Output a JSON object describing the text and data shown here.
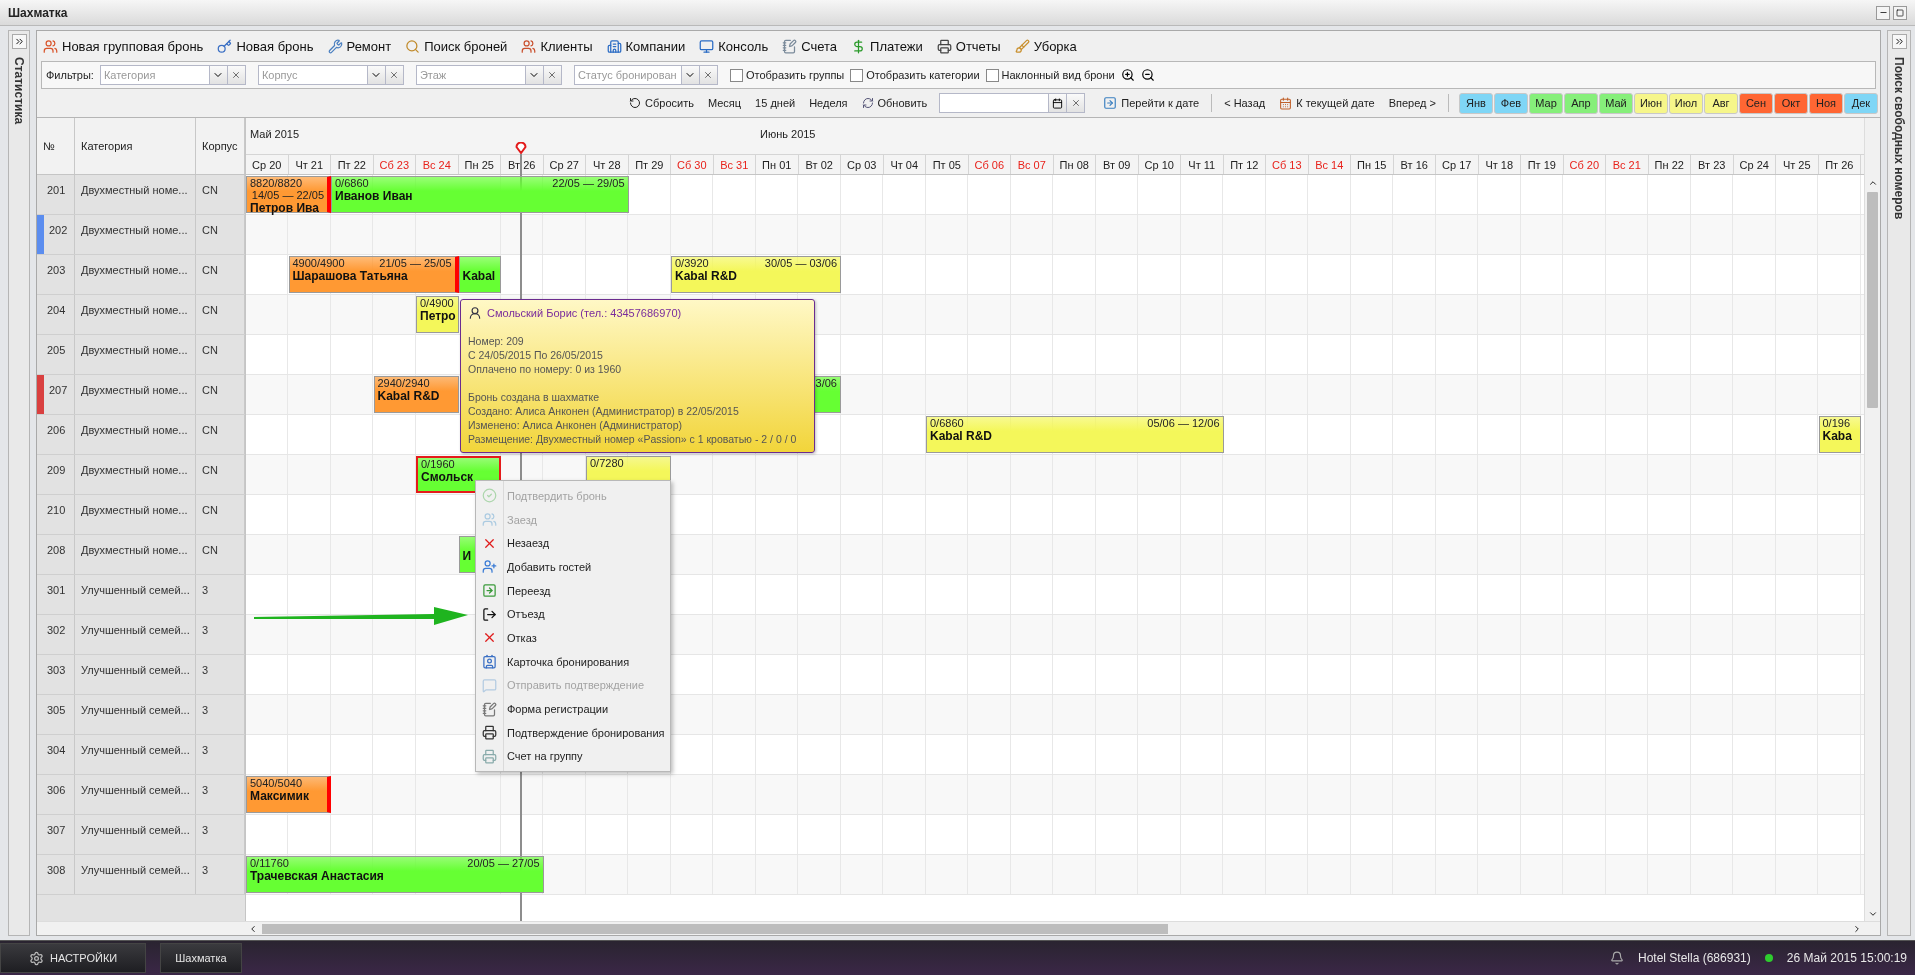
{
  "window": {
    "title": "Шахматка"
  },
  "left_panel": {
    "title": "Статистика"
  },
  "right_panel": {
    "title": "Поиск свободных номеров"
  },
  "toolbar": [
    "Новая групповая бронь",
    "Новая бронь",
    "Ремонт",
    "Поиск броней",
    "Клиенты",
    "Компании",
    "Консоль",
    "Счета",
    "Платежи",
    "Отчеты",
    "Уборка"
  ],
  "filters": {
    "label": "Фильтры:",
    "combos": [
      {
        "placeholder": "Категория"
      },
      {
        "placeholder": "Корпус"
      },
      {
        "placeholder": "Этаж"
      },
      {
        "placeholder": "Статус бронирован"
      }
    ],
    "checkboxes": [
      {
        "label": "Отобразить группы",
        "checked": false
      },
      {
        "label": "Отобразить категории",
        "checked": false
      },
      {
        "label": "Наклонный вид брони",
        "checked": false
      }
    ]
  },
  "nav": {
    "reset": "Сбросить",
    "views": [
      "Месяц",
      "15 дней",
      "Неделя"
    ],
    "refresh": "Обновить",
    "goto": "Перейти к дате",
    "back": "< Назад",
    "current": "К текущей дате",
    "forward": "Вперед >",
    "months": [
      {
        "label": "Янв",
        "color": "#7fd6f6"
      },
      {
        "label": "Фев",
        "color": "#7fd6f6"
      },
      {
        "label": "Мар",
        "color": "#86ef7a"
      },
      {
        "label": "Апр",
        "color": "#86ef7a"
      },
      {
        "label": "Май",
        "color": "#86ef7a"
      },
      {
        "label": "Июн",
        "color": "#f6f68a"
      },
      {
        "label": "Июл",
        "color": "#f6f68a"
      },
      {
        "label": "Авг",
        "color": "#f6f68a"
      },
      {
        "label": "Сен",
        "color": "#ff6633"
      },
      {
        "label": "Окт",
        "color": "#ff6633"
      },
      {
        "label": "Ноя",
        "color": "#ff6633"
      },
      {
        "label": "Дек",
        "color": "#7fd6f6"
      }
    ]
  },
  "grid": {
    "columns": [
      "№",
      "Категория",
      "Корпус"
    ],
    "days": [
      {
        "label": "Ср 20",
        "month": "Май 2015",
        "weekend": false,
        "today": false
      },
      {
        "label": "Чт 21",
        "weekend": false,
        "today": false
      },
      {
        "label": "Пт 22",
        "weekend": false,
        "today": false
      },
      {
        "label": "Сб 23",
        "weekend": true,
        "today": false
      },
      {
        "label": "Вс 24",
        "weekend": true,
        "today": false
      },
      {
        "label": "Пн 25",
        "weekend": false,
        "today": false
      },
      {
        "label": "Вт 26",
        "weekend": false,
        "today": true
      },
      {
        "label": "Ср 27",
        "weekend": false,
        "today": false
      },
      {
        "label": "Чт 28",
        "weekend": false,
        "today": false
      },
      {
        "label": "Пт 29",
        "weekend": false,
        "today": false
      },
      {
        "label": "Сб 30",
        "weekend": true,
        "today": false
      },
      {
        "label": "Вс 31",
        "weekend": true,
        "today": false
      },
      {
        "label": "Пн 01",
        "month": "Июнь 2015",
        "weekend": false,
        "today": false
      },
      {
        "label": "Вт 02",
        "weekend": false,
        "today": false
      },
      {
        "label": "Ср 03",
        "weekend": false,
        "today": false
      },
      {
        "label": "Чт 04",
        "weekend": false,
        "today": false
      },
      {
        "label": "Пт 05",
        "weekend": false,
        "today": false
      },
      {
        "label": "Сб 06",
        "weekend": true,
        "today": false
      },
      {
        "label": "Вс 07",
        "weekend": true,
        "today": false
      },
      {
        "label": "Пн 08",
        "weekend": false,
        "today": false
      },
      {
        "label": "Вт 09",
        "weekend": false,
        "today": false
      },
      {
        "label": "Ср 10",
        "weekend": false,
        "today": false
      },
      {
        "label": "Чт 11",
        "weekend": false,
        "today": false
      },
      {
        "label": "Пт 12",
        "weekend": false,
        "today": false
      },
      {
        "label": "Сб 13",
        "weekend": true,
        "today": false
      },
      {
        "label": "Вс 14",
        "weekend": true,
        "today": false
      },
      {
        "label": "Пн 15",
        "weekend": false,
        "today": false
      },
      {
        "label": "Вт 16",
        "weekend": false,
        "today": false
      },
      {
        "label": "Ср 17",
        "weekend": false,
        "today": false
      },
      {
        "label": "Чт 18",
        "weekend": false,
        "today": false
      },
      {
        "label": "Пт 19",
        "weekend": false,
        "today": false
      },
      {
        "label": "Сб 20",
        "weekend": true,
        "today": false
      },
      {
        "label": "Вс 21",
        "weekend": true,
        "today": false
      },
      {
        "label": "Пн 22",
        "weekend": false,
        "today": false
      },
      {
        "label": "Вт 23",
        "weekend": false,
        "today": false
      },
      {
        "label": "Ср 24",
        "weekend": false,
        "today": false
      },
      {
        "label": "Чт 25",
        "weekend": false,
        "today": false
      },
      {
        "label": "Пт 26",
        "weekend": false,
        "today": false
      }
    ],
    "rooms": [
      {
        "number": "201",
        "category": "Двухместный номе...",
        "building": "CN",
        "timeline": [
          {
            "kind": "booking",
            "amount": "8820/8820",
            "dates": "14/05 — 22/05",
            "name": "Петров Ива",
            "color": "#ff9933",
            "alert": true,
            "selected": false,
            "nights": [
              {
                "kind": "night"
              },
              {
                "kind": "night"
              }
            ]
          },
          {
            "kind": "booking",
            "amount": "0/6860",
            "dates": "22/05 — 29/05",
            "name": "Иванов Иван",
            "color": "#66ff33",
            "alert": false,
            "selected": false,
            "nights": [
              {
                "kind": "night"
              },
              {
                "kind": "night"
              },
              {
                "kind": "night"
              },
              {
                "kind": "night"
              },
              {
                "kind": "night"
              },
              {
                "kind": "night"
              },
              {
                "kind": "night"
              }
            ]
          }
        ]
      },
      {
        "number": "202",
        "category": "Двухместный номе...",
        "building": "CN",
        "color": "#5b8def"
      },
      {
        "number": "203",
        "category": "Двухместный номе...",
        "building": "CN",
        "timeline": [
          {
            "kind": "free"
          },
          {
            "kind": "booking",
            "amount": "4900/4900",
            "dates": "21/05 — 25/05",
            "name": "Шарашова Татьяна",
            "color": "#ff9933",
            "alert": true,
            "selected": false,
            "nights": [
              {
                "kind": "night"
              },
              {
                "kind": "night"
              },
              {
                "kind": "night"
              },
              {
                "kind": "night"
              }
            ]
          },
          {
            "kind": "booking",
            "name": "Kabal",
            "color": "#66ff33",
            "alert": false,
            "selected": false,
            "nights": [
              {
                "kind": "night"
              }
            ]
          },
          {
            "kind": "free"
          },
          {
            "kind": "free"
          },
          {
            "kind": "free"
          },
          {
            "kind": "free"
          },
          {
            "kind": "booking",
            "amount": "0/3920",
            "dates": "30/05 — 03/06",
            "name": "Kabal R&D",
            "color": "#f4f75a",
            "alert": false,
            "selected": false,
            "nights": [
              {
                "kind": "night"
              },
              {
                "kind": "night"
              },
              {
                "kind": "night"
              },
              {
                "kind": "night"
              }
            ]
          }
        ]
      },
      {
        "number": "204",
        "category": "Двухместный номе...",
        "building": "CN",
        "timeline": [
          {
            "kind": "free"
          },
          {
            "kind": "free"
          },
          {
            "kind": "free"
          },
          {
            "kind": "free"
          },
          {
            "kind": "booking",
            "amount": "0/4900",
            "name": "Петро",
            "color": "#f4f75a",
            "alert": false,
            "selected": false,
            "nights": [
              {
                "kind": "night"
              }
            ]
          }
        ]
      },
      {
        "number": "205",
        "category": "Двухместный номе...",
        "building": "CN"
      },
      {
        "number": "207",
        "category": "Двухместный номе...",
        "building": "CN",
        "color": "#d94040",
        "timeline": [
          {
            "kind": "free"
          },
          {
            "kind": "free"
          },
          {
            "kind": "free"
          },
          {
            "kind": "booking",
            "amount": "2940/2940",
            "name": "Kabal R&D",
            "color": "#ff9933",
            "alert": false,
            "selected": false,
            "nights": [
              {
                "kind": "night"
              },
              {
                "kind": "night"
              }
            ]
          },
          {
            "kind": "free"
          },
          {
            "kind": "free"
          },
          {
            "kind": "free"
          },
          {
            "kind": "free"
          },
          {
            "kind": "free"
          },
          {
            "kind": "free"
          },
          {
            "kind": "free"
          },
          {
            "kind": "booking",
            "dates": "3/06",
            "color": "#66ff33",
            "alert": false,
            "selected": false,
            "nights": [
              {
                "kind": "night"
              },
              {
                "kind": "night"
              }
            ]
          }
        ]
      },
      {
        "number": "206",
        "category": "Двухместный номе...",
        "building": "CN",
        "timeline": [
          {
            "kind": "free"
          },
          {
            "kind": "free"
          },
          {
            "kind": "free"
          },
          {
            "kind": "free"
          },
          {
            "kind": "free"
          },
          {
            "kind": "free"
          },
          {
            "kind": "free"
          },
          {
            "kind": "free"
          },
          {
            "kind": "free"
          },
          {
            "kind": "free"
          },
          {
            "kind": "free"
          },
          {
            "kind": "free"
          },
          {
            "kind": "free"
          },
          {
            "kind": "free"
          },
          {
            "kind": "free"
          },
          {
            "kind": "free"
          },
          {
            "kind": "booking",
            "amount": "0/6860",
            "dates": "05/06 — 12/06",
            "name": "Kabal R&D",
            "color": "#f4f75a",
            "alert": false,
            "selected": false,
            "nights": [
              {
                "kind": "night"
              },
              {
                "kind": "night"
              },
              {
                "kind": "night"
              },
              {
                "kind": "night"
              },
              {
                "kind": "night"
              },
              {
                "kind": "night"
              },
              {
                "kind": "night"
              }
            ]
          },
          {
            "kind": "free"
          },
          {
            "kind": "free"
          },
          {
            "kind": "free"
          },
          {
            "kind": "free"
          },
          {
            "kind": "free"
          },
          {
            "kind": "free"
          },
          {
            "kind": "free"
          },
          {
            "kind": "free"
          },
          {
            "kind": "free"
          },
          {
            "kind": "free"
          },
          {
            "kind": "free"
          },
          {
            "kind": "free"
          },
          {
            "kind": "free"
          },
          {
            "kind": "free"
          },
          {
            "kind": "booking",
            "amount": "0/196",
            "name": "Kaba",
            "color": "#f4f75a",
            "selected": false,
            "nights": [
              {
                "kind": "night"
              }
            ]
          }
        ]
      },
      {
        "number": "209",
        "category": "Двухместный номе...",
        "building": "CN",
        "timeline": [
          {
            "kind": "free"
          },
          {
            "kind": "free"
          },
          {
            "kind": "free"
          },
          {
            "kind": "free"
          },
          {
            "kind": "booking",
            "amount": "0/1960",
            "name": "Смольск",
            "color": "#66ff33",
            "selected": true,
            "nights": [
              {
                "kind": "night"
              },
              {
                "kind": "night"
              }
            ]
          },
          {
            "kind": "free"
          },
          {
            "kind": "free"
          },
          {
            "kind": "booking",
            "amount": "0/7280",
            "color": "#f4f75a",
            "selected": false,
            "nights": [
              {
                "kind": "night"
              },
              {
                "kind": "night"
              }
            ]
          }
        ]
      },
      {
        "number": "210",
        "category": "Двухместный номе...",
        "building": "CN"
      },
      {
        "number": "208",
        "category": "Двухместный номе...",
        "building": "CN",
        "timeline": [
          {
            "kind": "free"
          },
          {
            "kind": "free"
          },
          {
            "kind": "free"
          },
          {
            "kind": "free"
          },
          {
            "kind": "free"
          },
          {
            "kind": "booking",
            "name": "И",
            "color": "#66ff33",
            "selected": false,
            "nights": [
              {
                "kind": "night"
              },
              {
                "kind": "night"
              }
            ]
          }
        ]
      },
      {
        "number": "301",
        "category": "Улучшенный семей...",
        "building": "3"
      },
      {
        "number": "302",
        "category": "Улучшенный семей...",
        "building": "3"
      },
      {
        "number": "303",
        "category": "Улучшенный семей...",
        "building": "3"
      },
      {
        "number": "305",
        "category": "Улучшенный семей...",
        "building": "3"
      },
      {
        "number": "304",
        "category": "Улучшенный семей...",
        "building": "3"
      },
      {
        "number": "306",
        "category": "Улучшенный семей...",
        "building": "3",
        "timeline": [
          {
            "kind": "booking",
            "amount": "5040/5040",
            "name": "Максимик",
            "color": "#ff9933",
            "alert": true,
            "selected": false,
            "nights": [
              {
                "kind": "night"
              },
              {
                "kind": "night"
              }
            ]
          }
        ]
      },
      {
        "number": "307",
        "category": "Улучшенный семей...",
        "building": "3"
      },
      {
        "number": "308",
        "category": "Улучшенный семей...",
        "building": "3",
        "timeline": [
          {
            "kind": "booking",
            "amount": "0/11760",
            "dates": "20/05 — 27/05",
            "name": "Трачевская Анастасия",
            "color": "#66ff33",
            "alert": false,
            "selected": false,
            "nights": [
              {
                "kind": "night"
              },
              {
                "kind": "night"
              },
              {
                "kind": "night"
              },
              {
                "kind": "night"
              },
              {
                "kind": "night"
              },
              {
                "kind": "night"
              },
              {
                "kind": "night"
              }
            ]
          }
        ]
      }
    ]
  },
  "tooltip": {
    "guest": "Смольский Борис (тел.: 43457686970)",
    "sections": [
      [
        "Номер: 209",
        "С 24/05/2015 По 26/05/2015",
        "Оплачено по номеру: 0 из 1960"
      ],
      [
        "Бронь создана в шахматке",
        "Создано: Алиса Анконен (Администратор) в 22/05/2015",
        "Изменено: Алиса Анконен (Администратор)",
        "Размещение: Двухместный номер «Passion» с 1 кроватью - 2 / 0 / 0"
      ]
    ]
  },
  "context_menu": [
    {
      "label": "Подтвердить бронь",
      "disabled": true
    },
    {
      "label": "Заезд",
      "disabled": true
    },
    {
      "label": "Незаезд",
      "disabled": false
    },
    {
      "label": "Добавить гостей",
      "disabled": false
    },
    {
      "label": "Переезд",
      "disabled": false
    },
    {
      "label": "Отъезд",
      "disabled": false
    },
    {
      "label": "Отказ",
      "disabled": false
    },
    {
      "label": "Карточка бронирования",
      "disabled": false
    },
    {
      "label": "Отправить подтверждение",
      "disabled": true
    },
    {
      "label": "Форма регистрации",
      "disabled": false
    },
    {
      "label": "Подтверждение бронирования",
      "disabled": false
    },
    {
      "label": "Счет на группу",
      "disabled": false
    }
  ],
  "taskbar": {
    "settings": "НАСТРОЙКИ",
    "task": "Шахматка",
    "hotel": "Hotel Stella (686931)",
    "online": true,
    "datetime": "26 Май 2015 15:00:19"
  }
}
